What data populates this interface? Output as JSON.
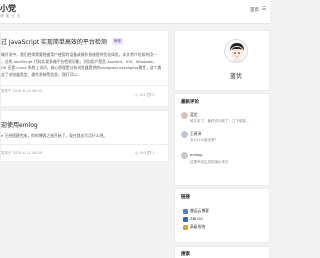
{
  "header": {
    "site_title": "小党",
    "site_subtitle": "博 客 日 志",
    "nav_home": "首页",
    "nav_icon": "☰"
  },
  "posts": [
    {
      "title": "过 JavaScript 实现简单高效的平台检测",
      "tag": "教程",
      "excerpt_lines": [
        "端开发中，我们经常需要根据用户使用的设备或操作系统提供优化体验。本文将介绍如何用一",
        "，过的 JavaScript 代码实现多端平台检测功能，识别用户是否 Android、iOS、Windows、",
        "OS 还是 Linux 系统上访问，核心原理是分析浏览器提供的navigator.userAgent属性，这个属",
        "含了浏览器类型、操作系统等信息。我们可以..."
      ],
      "meta": "发布于 2025-6-13 08:00",
      "stats": "◎ 151   💬 0"
    },
    {
      "title": "迎使用emlog",
      "excerpt_lines": [
        "e 已经搭建完成，你的博客之旅开始了，现在就去写点什么吧。"
      ],
      "meta": "发布于 2025-6-11 08:00",
      "stats": "◎ 150   💬 1"
    }
  ],
  "profile": {
    "name": "蓝优"
  },
  "comments_panel": {
    "title": "最新评论",
    "items": [
      {
        "user": "蓝优",
        "text": "哈文末了，最终说问到了，之下错量..."
      },
      {
        "user": "王继泽",
        "text": "怎么什么都没有？"
      },
      {
        "user": "emlog",
        "text": "这是系统生成的演示评论"
      }
    ]
  },
  "links_panel": {
    "title": "链接",
    "items": [
      {
        "label": "搬运云博客",
        "color": "#4a86d4"
      },
      {
        "label": "ZBLOG",
        "color": "#2a6fb8"
      },
      {
        "label": "高级系统",
        "color": "#e0a03c"
      }
    ]
  },
  "search_panel": {
    "title": "搜索"
  }
}
